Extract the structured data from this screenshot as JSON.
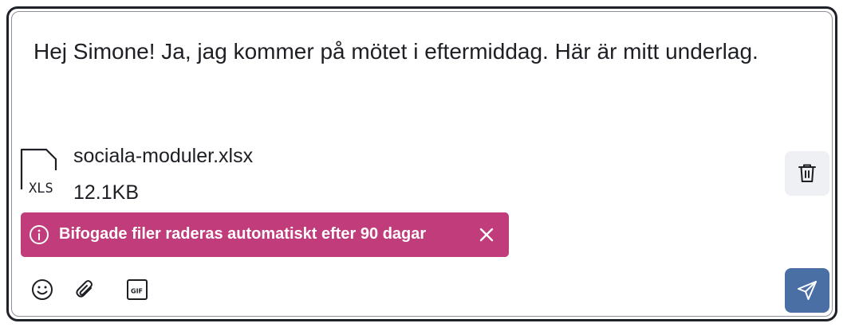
{
  "composer": {
    "message_text": "Hej Simone! Ja, jag kommer på mötet i eftermiddag. Här är mitt underlag."
  },
  "attachment": {
    "file_name": "sociala-moduler.xlsx",
    "file_size": "12.1KB",
    "file_type_label": "XLS",
    "icon": "xls-file-icon"
  },
  "notice": {
    "text": "Bifogade filer raderas automatiskt efter 90 dagar",
    "color": "#c03c7b"
  },
  "toolbar": {
    "icons": [
      "emoji-icon",
      "paperclip-icon",
      "gif-icon"
    ],
    "gif_label": "GIF"
  },
  "colors": {
    "send_button": "#4a6fa5",
    "delete_button_bg": "#eef0f3"
  }
}
